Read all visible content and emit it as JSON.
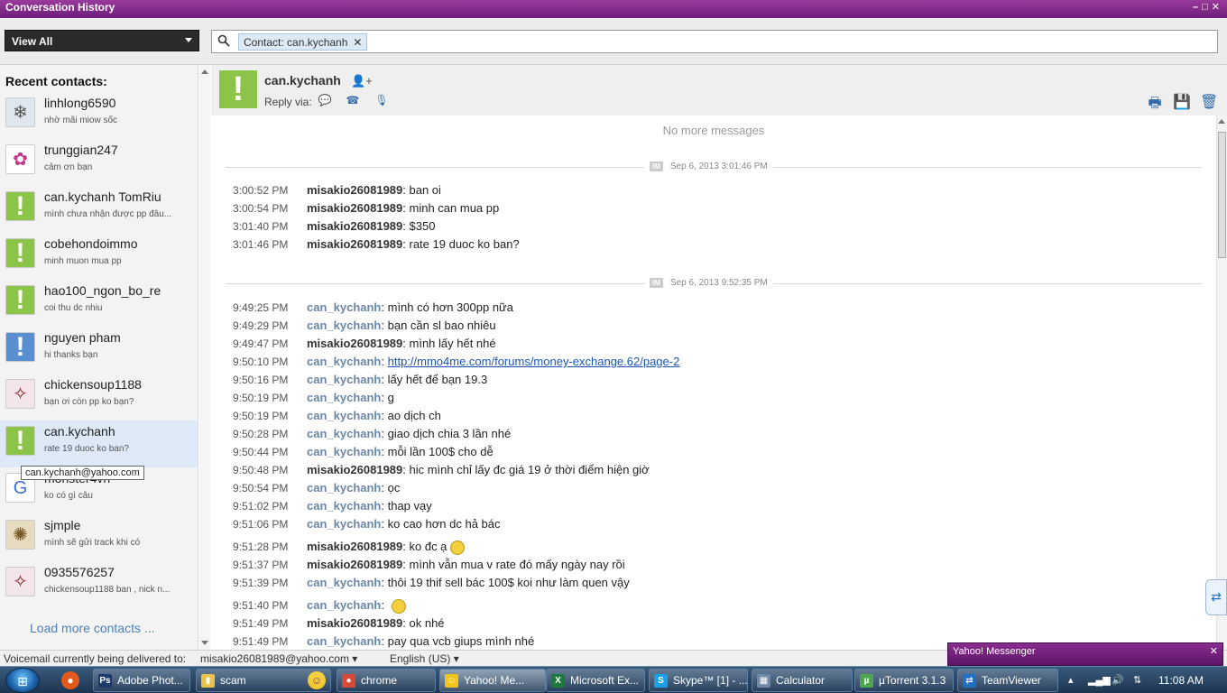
{
  "window": {
    "title": "Conversation History"
  },
  "toolbar": {
    "view_filter": "View All",
    "search_chip": "Contact: can.kychanh",
    "search_chip_close": "✕"
  },
  "sidebar": {
    "title": "Recent contacts:",
    "contacts": [
      {
        "name": "linhlong6590",
        "status": "nhờ mãi miow sốc"
      },
      {
        "name": "trunggian247",
        "status": "cảm ơn bạn"
      },
      {
        "name": "can.kychanh TomRiu",
        "status": "mình chưa nhận được pp đâu..."
      },
      {
        "name": "cobehondoimmo",
        "status": "minh muon mua pp"
      },
      {
        "name": "hao100_ngon_bo_re",
        "status": "coi thu dc nhiu"
      },
      {
        "name": "nguyen pham",
        "status": "hi thanks bạn"
      },
      {
        "name": "chickensoup1188",
        "status": "bạn ơi còn pp ko bạn?"
      },
      {
        "name": "can.kychanh",
        "status": "rate 19 duoc ko ban?"
      },
      {
        "name": "monster4vn",
        "status": "ko có gì câu"
      },
      {
        "name": "sjmple",
        "status": "mình sẽ gửi track khi có"
      },
      {
        "name": "0935576257",
        "status": "chickensoup1188 ban , nick n..."
      }
    ],
    "load_more": "Load more contacts ...",
    "tooltip": "can.kychanh@yahoo.com"
  },
  "conversation": {
    "contact_name": "can.kychanh",
    "reply_via_label": "Reply via:",
    "no_more": "No more messages",
    "sessions": [
      {
        "badge": "IM",
        "date": "Sep 6, 2013 3:01:46 PM",
        "messages": [
          {
            "time": "3:00:52 PM",
            "sender": "misakio26081989",
            "text": "ban oi"
          },
          {
            "time": "3:00:54 PM",
            "sender": "misakio26081989",
            "text": "minh can mua pp"
          },
          {
            "time": "3:01:40 PM",
            "sender": "misakio26081989",
            "text": "$350"
          },
          {
            "time": "3:01:46 PM",
            "sender": "misakio26081989",
            "text": "rate 19 duoc ko ban?"
          }
        ]
      },
      {
        "badge": "IM",
        "date": "Sep 6, 2013 9:52:35 PM",
        "messages": [
          {
            "time": "9:49:25 PM",
            "sender": "can_kychanh",
            "text": "mình có hơn 300pp nữa"
          },
          {
            "time": "9:49:29 PM",
            "sender": "can_kychanh",
            "text": "bạn cần sl bao nhiêu"
          },
          {
            "time": "9:49:47 PM",
            "sender": "misakio26081989",
            "text": "mình lấy hết nhé"
          },
          {
            "time": "9:50:10 PM",
            "sender": "can_kychanh",
            "text": "http://mmo4me.com/forums/money-exchange.62/page-2"
          },
          {
            "time": "9:50:16 PM",
            "sender": "can_kychanh",
            "text": "lấy hết để bạn 19.3"
          },
          {
            "time": "9:50:19 PM",
            "sender": "can_kychanh",
            "text": "g"
          },
          {
            "time": "9:50:19 PM",
            "sender": "can_kychanh",
            "text": "ao dịch ch"
          },
          {
            "time": "9:50:28 PM",
            "sender": "can_kychanh",
            "text": "giao dịch chia 3 lần nhé"
          },
          {
            "time": "9:50:44 PM",
            "sender": "can_kychanh",
            "text": "mỗi lần 100$ cho dễ"
          },
          {
            "time": "9:50:48 PM",
            "sender": "misakio26081989",
            "text": "hic mình chỉ lấy đc giá 19 ở thời điểm hiện giờ"
          },
          {
            "time": "9:50:54 PM",
            "sender": "can_kychanh",
            "text": "ọc"
          },
          {
            "time": "9:51:02 PM",
            "sender": "can_kychanh",
            "text": "thap vạy"
          },
          {
            "time": "9:51:06 PM",
            "sender": "can_kychanh",
            "text": "ko cao hơn dc hả bác"
          },
          {
            "time": "9:51:28 PM",
            "sender": "misakio26081989",
            "text": "ko đc ạ"
          },
          {
            "time": "9:51:37 PM",
            "sender": "misakio26081989",
            "text": "mình vẫn mua v rate đó mấy ngày nay rồi"
          },
          {
            "time": "9:51:39 PM",
            "sender": "can_kychanh",
            "text": "thôi 19 thif sell bác 100$ koi như làm quen vậy"
          },
          {
            "time": "9:51:40 PM",
            "sender": "can_kychanh",
            "text": ""
          },
          {
            "time": "9:51:49 PM",
            "sender": "misakio26081989",
            "text": "ok nhé"
          },
          {
            "time": "9:51:49 PM",
            "sender": "can_kychanh",
            "text": "pay qua vcb giups mình nhé"
          }
        ]
      }
    ]
  },
  "statusbar": {
    "voicemail_label": "Voicemail currently being delivered to:",
    "voicemail_target": "misakio26081989@yahoo.com",
    "language": "English (US)"
  },
  "notification": {
    "title": "Yahoo! Messenger"
  },
  "taskbar": {
    "items": [
      {
        "label": "Adobe Phot...",
        "icon": "Ps",
        "color": "#1b3a6b"
      },
      {
        "label": "scam",
        "icon": "▮",
        "color": "#e8c24a"
      },
      {
        "label": "chrome",
        "icon": "●",
        "color": "#d84a38"
      },
      {
        "label": "Yahoo! Me...",
        "icon": "☺",
        "color": "#f0c419"
      },
      {
        "label": "Microsoft Ex...",
        "icon": "X",
        "color": "#1d7a3c"
      },
      {
        "label": "Skype™ [1] - ...",
        "icon": "S",
        "color": "#1aa0e6"
      },
      {
        "label": "Calculator",
        "icon": "▦",
        "color": "#6f8aa8"
      },
      {
        "label": "µTorrent 3.1.3",
        "icon": "µ",
        "color": "#4ca64c"
      },
      {
        "label": "TeamViewer",
        "icon": "⇄",
        "color": "#1f6fc2"
      }
    ],
    "clock": "11:08 AM"
  }
}
